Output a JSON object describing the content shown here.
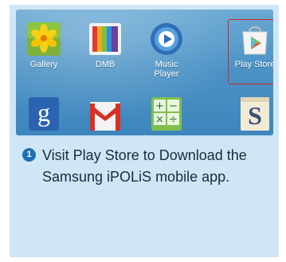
{
  "apps": [
    {
      "label": "Gallery",
      "icon": "gallery-icon"
    },
    {
      "label": "DMB",
      "icon": "dmb-icon"
    },
    {
      "label": "Music\nPlayer",
      "icon": "music-player-icon"
    },
    {
      "label": "Play Store",
      "icon": "play-store-icon",
      "highlighted": true
    },
    {
      "label": "",
      "icon": "google-search-icon"
    },
    {
      "label": "",
      "icon": "gmail-icon"
    },
    {
      "label": "",
      "icon": "calculator-icon"
    },
    {
      "label": "",
      "icon": "s-note-icon"
    }
  ],
  "instruction": {
    "step": "1",
    "text": "Visit Play Store to Download the Samsung iPOLiS mobile app."
  },
  "colors": {
    "panel": "#cfe6f6",
    "screen": "#4d93c6",
    "highlight": "#d32424",
    "badge": "#1e6fb3"
  }
}
